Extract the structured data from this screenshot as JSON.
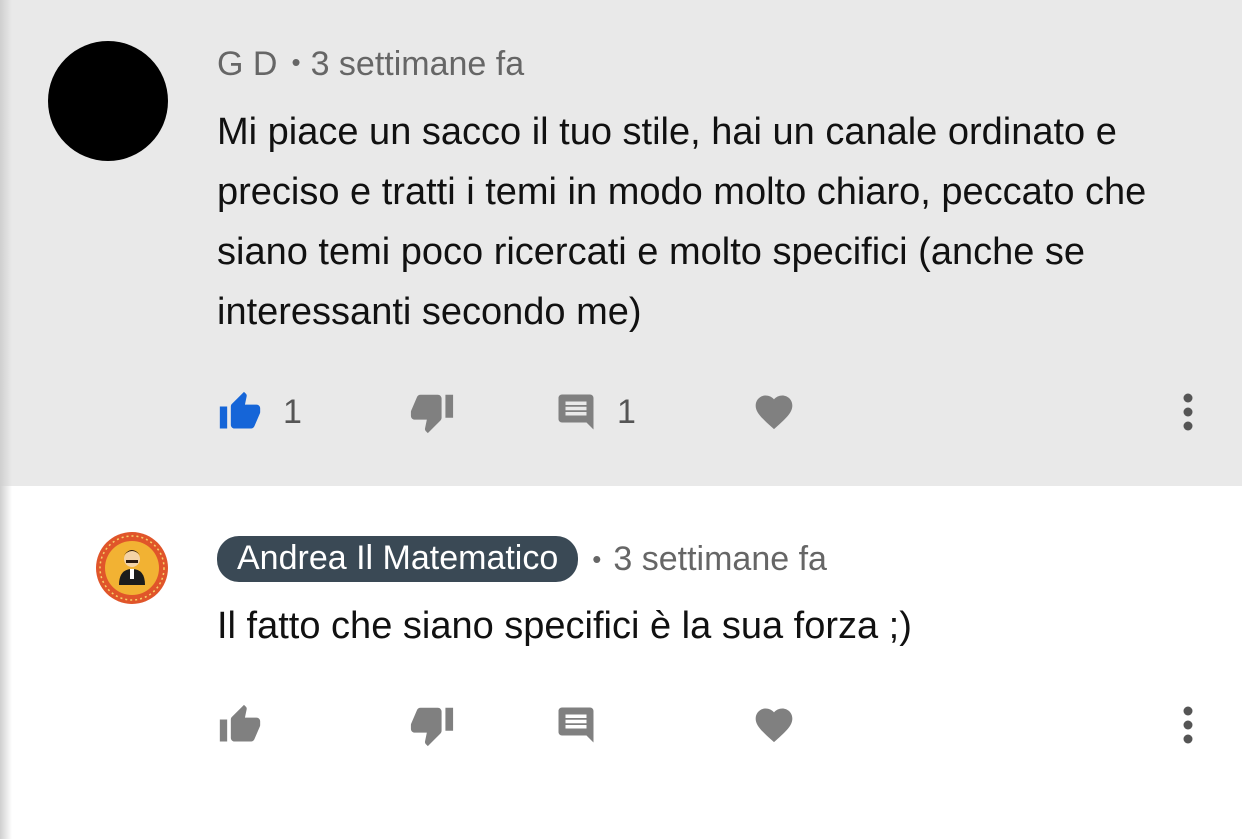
{
  "comments": {
    "top": {
      "author": "G D",
      "separator": "•",
      "time": "3 settimane fa",
      "text": "Mi piace un sacco il tuo stile, hai un canale ordinato e preciso e tratti i temi in modo molto chiaro, peccato che siano temi poco ricercati e molto specifici (anche se interessanti secondo me)",
      "likes": "1",
      "replies": "1",
      "liked": true,
      "icons": [
        "thumb-up-icon",
        "thumb-down-icon",
        "reply-icon",
        "heart-icon",
        "more-vertical-icon"
      ]
    },
    "reply": {
      "author": "Andrea Il Matematico",
      "separator": "•",
      "time": "3 settimane fa",
      "text": "Il fatto che siano specifici è la sua forza ;)",
      "liked": false,
      "icons": [
        "thumb-up-icon",
        "thumb-down-icon",
        "reply-icon",
        "heart-icon",
        "more-vertical-icon"
      ]
    }
  },
  "colors": {
    "top_background": "#e9e9e9",
    "reply_background": "#ffffff",
    "like_active": "#1565d8",
    "icon_gray": "#808080",
    "author_chip": "#3a4955"
  }
}
